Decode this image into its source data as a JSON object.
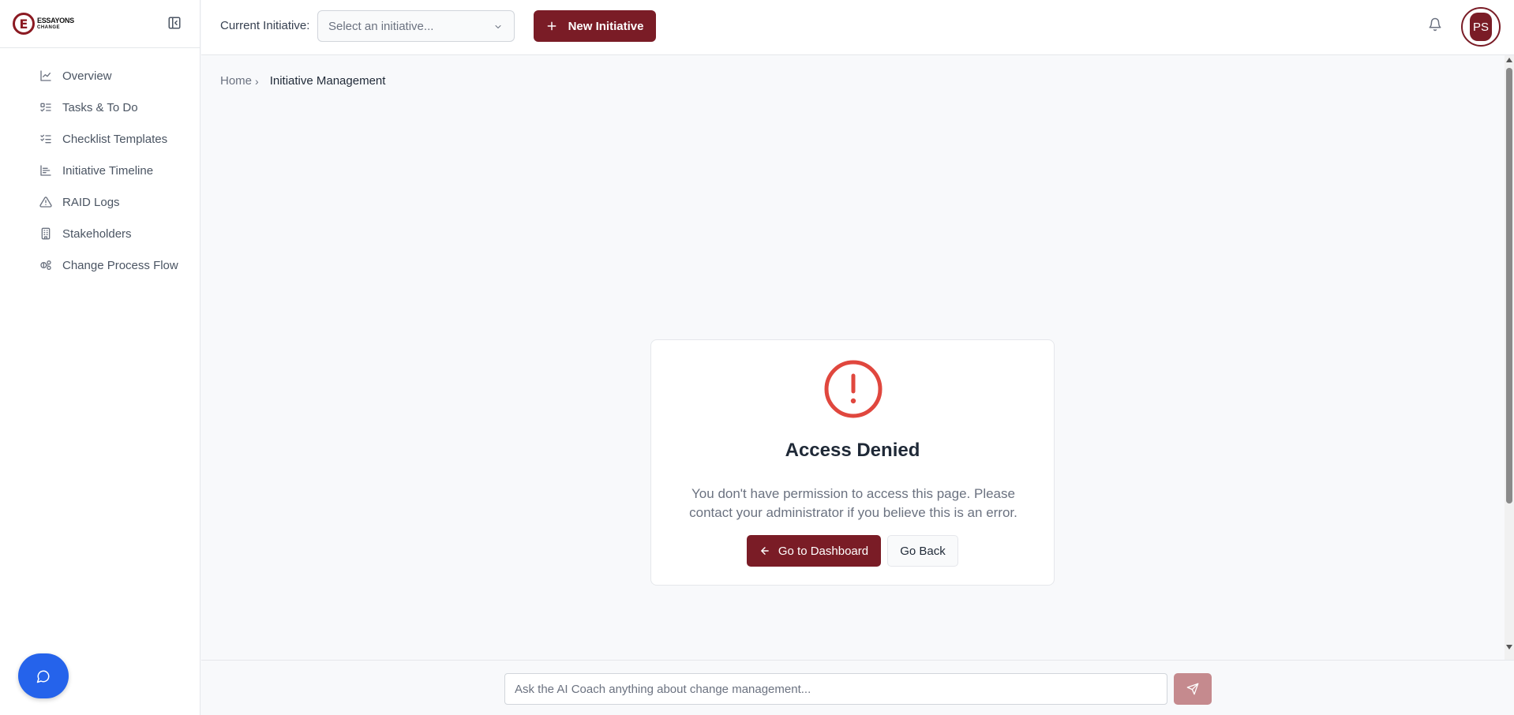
{
  "brand": {
    "logo_letter": "E",
    "name_line1": "ESSAYONS",
    "name_line2": "CHANGE",
    "accent": "#7a1c26"
  },
  "sidebar": {
    "items": [
      {
        "label": "Overview",
        "icon": "line-chart-icon"
      },
      {
        "label": "Tasks & To Do",
        "icon": "list-todo-icon"
      },
      {
        "label": "Checklist Templates",
        "icon": "list-checks-icon"
      },
      {
        "label": "Initiative Timeline",
        "icon": "timeline-chart-icon"
      },
      {
        "label": "RAID Logs",
        "icon": "warning-triangle-icon"
      },
      {
        "label": "Stakeholders",
        "icon": "building-icon"
      },
      {
        "label": "Change Process Flow",
        "icon": "process-flow-icon"
      }
    ]
  },
  "header": {
    "initiative_label": "Current Initiative:",
    "initiative_placeholder": "Select an initiative...",
    "new_initiative_label": "New Initiative",
    "user_initials": "PS"
  },
  "breadcrumb": {
    "home": "Home",
    "current": "Initiative Management"
  },
  "error": {
    "title": "Access Denied",
    "message": "You don't have permission to access this page. Please contact your administrator if you believe this is an error.",
    "dashboard_label": "Go to Dashboard",
    "back_label": "Go Back",
    "icon_color": "#e0473e"
  },
  "ai_coach": {
    "placeholder": "Ask the AI Coach anything about change management..."
  }
}
